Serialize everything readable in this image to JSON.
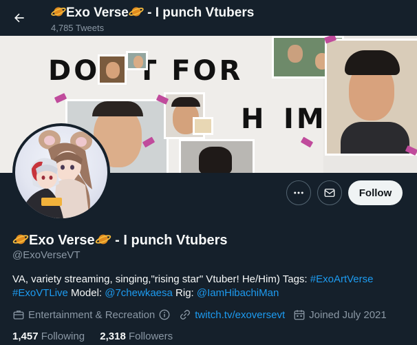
{
  "header": {
    "name": "Exo Verse",
    "name_suffix": " - I punch Vtubers",
    "tweet_count": "4,785 Tweets"
  },
  "banner": {
    "line1_left": "DO",
    "line1_right": "T FOR",
    "line2_left": "H",
    "line2_right": "IM"
  },
  "actions": {
    "more_icon": "ellipsis-icon",
    "message_icon": "envelope-icon",
    "follow_label": "Follow"
  },
  "profile": {
    "name": "Exo Verse",
    "name_suffix": " - I punch Vtubers",
    "handle": "@ExoVerseVT",
    "bio": {
      "text1": "VA, variety streaming, singing,\"rising star\" Vtuber! He/Him) Tags: ",
      "tag1": "#ExoArtVerse",
      "tag2": "#ExoVTLive",
      "text2": " Model: ",
      "model_link": "@7chewkaesa",
      "text3": " Rig: ",
      "rig_link": "@IamHibachiMan"
    },
    "category": "Entertainment & Recreation",
    "website": "twitch.tv/exoversevt",
    "joined": "Joined July 2021"
  },
  "stats": {
    "following_count": "1,457",
    "following_label": " Following",
    "followers_count": "2,318",
    "followers_label": " Followers"
  },
  "colors": {
    "background": "#15202b",
    "link": "#1d9bf0",
    "secondary_text": "#8b98a5",
    "follow_button": "#eff3f4"
  }
}
